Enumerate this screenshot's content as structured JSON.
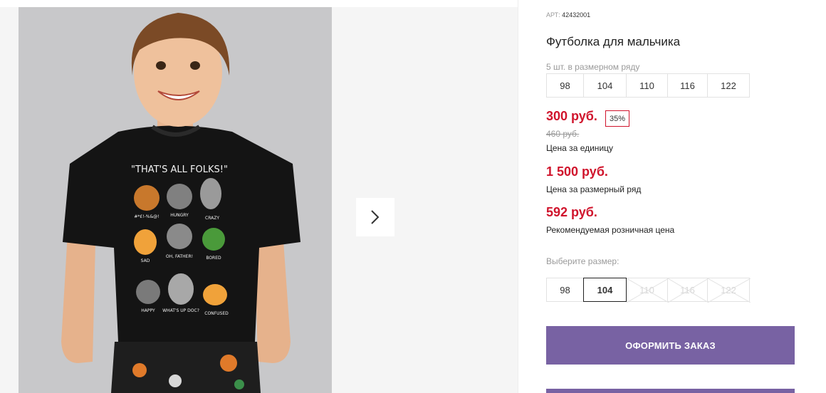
{
  "gallery": {
    "next_icon": "chevron-right-icon",
    "shirt_slogan": "\"THAT'S ALL FOLKS!\"",
    "face_captions": [
      "#*£!-%&@!",
      "HUNGRY",
      "CRAZY",
      "SAD",
      "OH, FATHER!",
      "BORED",
      "HAPPY",
      "WHAT'S UP DOC?",
      "CONFUSED"
    ]
  },
  "product": {
    "sku_label": "АРТ:",
    "sku_value": "42432001",
    "title": "Футболка для мальчика",
    "pack_note": "5 шт. в размерном ряду",
    "pack_sizes": [
      "98",
      "104",
      "110",
      "116",
      "122"
    ],
    "unit_price": "300 руб.",
    "discount": "35%",
    "old_price": "460 руб.",
    "unit_price_caption": "Цена за единицу",
    "pack_price": "1 500 руб.",
    "pack_price_caption": "Цена за размерный ряд",
    "retail_price": "592 руб.",
    "retail_price_caption": "Рекомендуемая розничная цена",
    "choose_size_label": "Выберите размер:",
    "size_options": [
      {
        "label": "98",
        "state": "available"
      },
      {
        "label": "104",
        "state": "selected"
      },
      {
        "label": "110",
        "state": "unavailable"
      },
      {
        "label": "116",
        "state": "unavailable"
      },
      {
        "label": "122",
        "state": "unavailable"
      }
    ],
    "order_button": "ОФОРМИТЬ ЗАКАЗ"
  },
  "colors": {
    "price_red": "#d0142c",
    "button_purple": "#7862a3",
    "gallery_bg": "#f5f5f5"
  }
}
